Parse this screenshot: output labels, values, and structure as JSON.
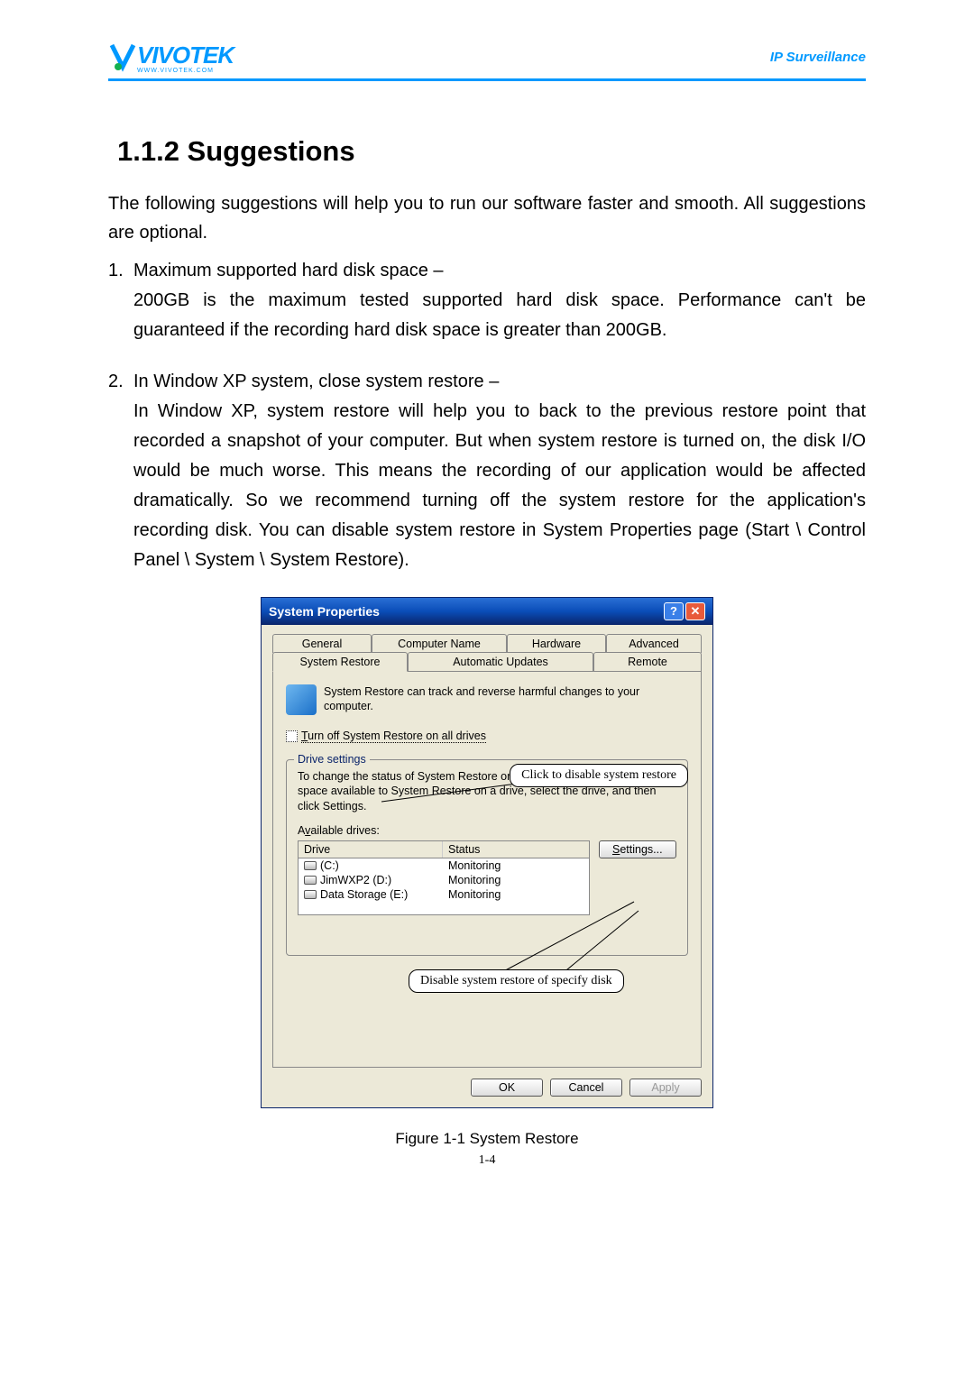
{
  "header": {
    "logo_main": "VIVOTEK",
    "logo_sub": "WWW.VIVOTEK.COM",
    "right": "IP Surveillance"
  },
  "section": {
    "heading": "1.1.2  Suggestions",
    "intro": "The following suggestions will help you to run our software faster and smooth. All suggestions are optional."
  },
  "items": [
    {
      "num": "1.",
      "title": "Maximum supported hard disk space  –",
      "body": "200GB is the maximum tested supported hard disk space. Performance can't be guaranteed if the recording hard disk space is greater than 200GB."
    },
    {
      "num": "2.",
      "title": "In Window XP system, close system restore  –",
      "body": "In Window XP, system restore will help you to back to the previous restore point that recorded a snapshot of your computer. But when system restore is turned on, the disk I/O would be much worse. This means the recording of our application would be affected dramatically. So we recommend turning off the system restore for the application's recording disk. You can disable system restore in System Properties page (Start \\ Control Panel \\ System \\ System Restore)."
    }
  ],
  "dialog": {
    "title": "System Properties",
    "tabs_row1": [
      "General",
      "Computer Name",
      "Hardware",
      "Advanced"
    ],
    "tabs_row2": [
      "System Restore",
      "Automatic Updates",
      "Remote"
    ],
    "desc1": "System Restore can track and reverse harmful changes to your computer.",
    "chk_label": "Turn off System Restore on all drives",
    "fieldset_legend": "Drive settings",
    "ds_desc": "To change the status of System Restore or the maximum amount of disk space available to System Restore on a drive, select the drive, and then click Settings.",
    "avail_label": "Available drives:",
    "col_drive": "Drive",
    "col_status": "Status",
    "drives": [
      {
        "name": "(C:)",
        "status": "Monitoring"
      },
      {
        "name": "JimWXP2 (D:)",
        "status": "Monitoring"
      },
      {
        "name": "Data Storage (E:)",
        "status": "Monitoring"
      }
    ],
    "settings_btn": "Settings...",
    "btn_ok": "OK",
    "btn_cancel": "Cancel",
    "btn_apply": "Apply"
  },
  "callouts": {
    "c1": "Click to disable system restore",
    "c2": "Disable system restore of specify disk"
  },
  "figure_caption": "Figure 1-1 System Restore",
  "page_number": "1-4"
}
